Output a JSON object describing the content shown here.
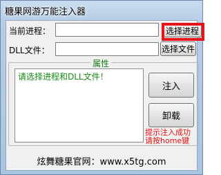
{
  "window": {
    "title": "糖果网游万能注入器"
  },
  "process_row": {
    "label": "当前进程：",
    "value": "",
    "button_label": "选择进程"
  },
  "dll_row": {
    "label": "DLL文件：",
    "value": "",
    "button_label": "选择文件"
  },
  "properties": {
    "legend": "属性",
    "status_text": "请选择进程和DLL文件！",
    "inject_label": "注入",
    "unload_label": "卸载",
    "hint_line1": "提示注入成功",
    "hint_line2": "请按home键"
  },
  "footer": {
    "text": "炫舞糖果官网：www.x5tg.com"
  },
  "colors": {
    "highlight": "#e8141a",
    "status_text": "#148c14",
    "hint_text": "#e01010"
  }
}
